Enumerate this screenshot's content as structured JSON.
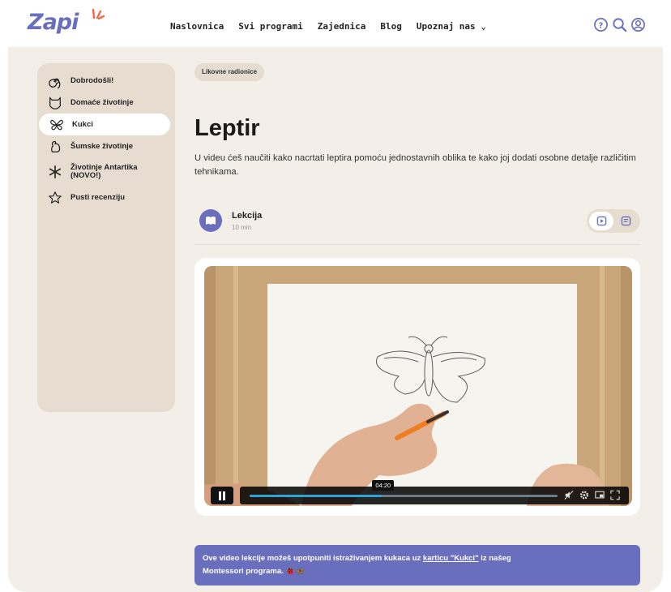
{
  "brand": {
    "name": "Zapi",
    "color": "#6a6fbd",
    "accent": "#f2694a"
  },
  "nav": {
    "items": [
      {
        "label": "Naslovnica"
      },
      {
        "label": "Svi programi"
      },
      {
        "label": "Zajednica"
      },
      {
        "label": "Blog"
      },
      {
        "label": "Upoznaj nas ⌄"
      }
    ]
  },
  "header_icons": [
    "help-icon",
    "search-icon",
    "account-icon"
  ],
  "sidebar": {
    "items": [
      {
        "label": "Dobrodošli!",
        "icon": "spiral-icon"
      },
      {
        "label": "Domaće životinje",
        "icon": "cat-icon"
      },
      {
        "label": "Kukci",
        "icon": "butterfly-icon",
        "active": true
      },
      {
        "label": "Šumske životinje",
        "icon": "squirrel-icon"
      },
      {
        "label": "Životinje Antartika",
        "label2": "(NOVO!)",
        "icon": "snowflake-icon"
      },
      {
        "label": "Pusti recenziju",
        "icon": "star-icon"
      }
    ]
  },
  "main": {
    "category_chip": "Likovne radionice",
    "title": "Leptir",
    "description": "U videu ćeš naučiti kako nacrtati leptira pomoću jednostavnih oblika te kako joj dodati osobne detalje različitim tehnikama.",
    "lesson": {
      "title": "Lekcija",
      "duration": "10 min"
    },
    "video": {
      "time_tooltip": "04:20",
      "progress": 0.43
    },
    "info": {
      "text_before": "Ove video lekcije možeš upotpuniti istraživanjem kukaca uz ",
      "link": "karticu \"Kukci\"",
      "text_after": " iz našeg",
      "line2": "Montessori programa. 🐞🦋"
    }
  }
}
